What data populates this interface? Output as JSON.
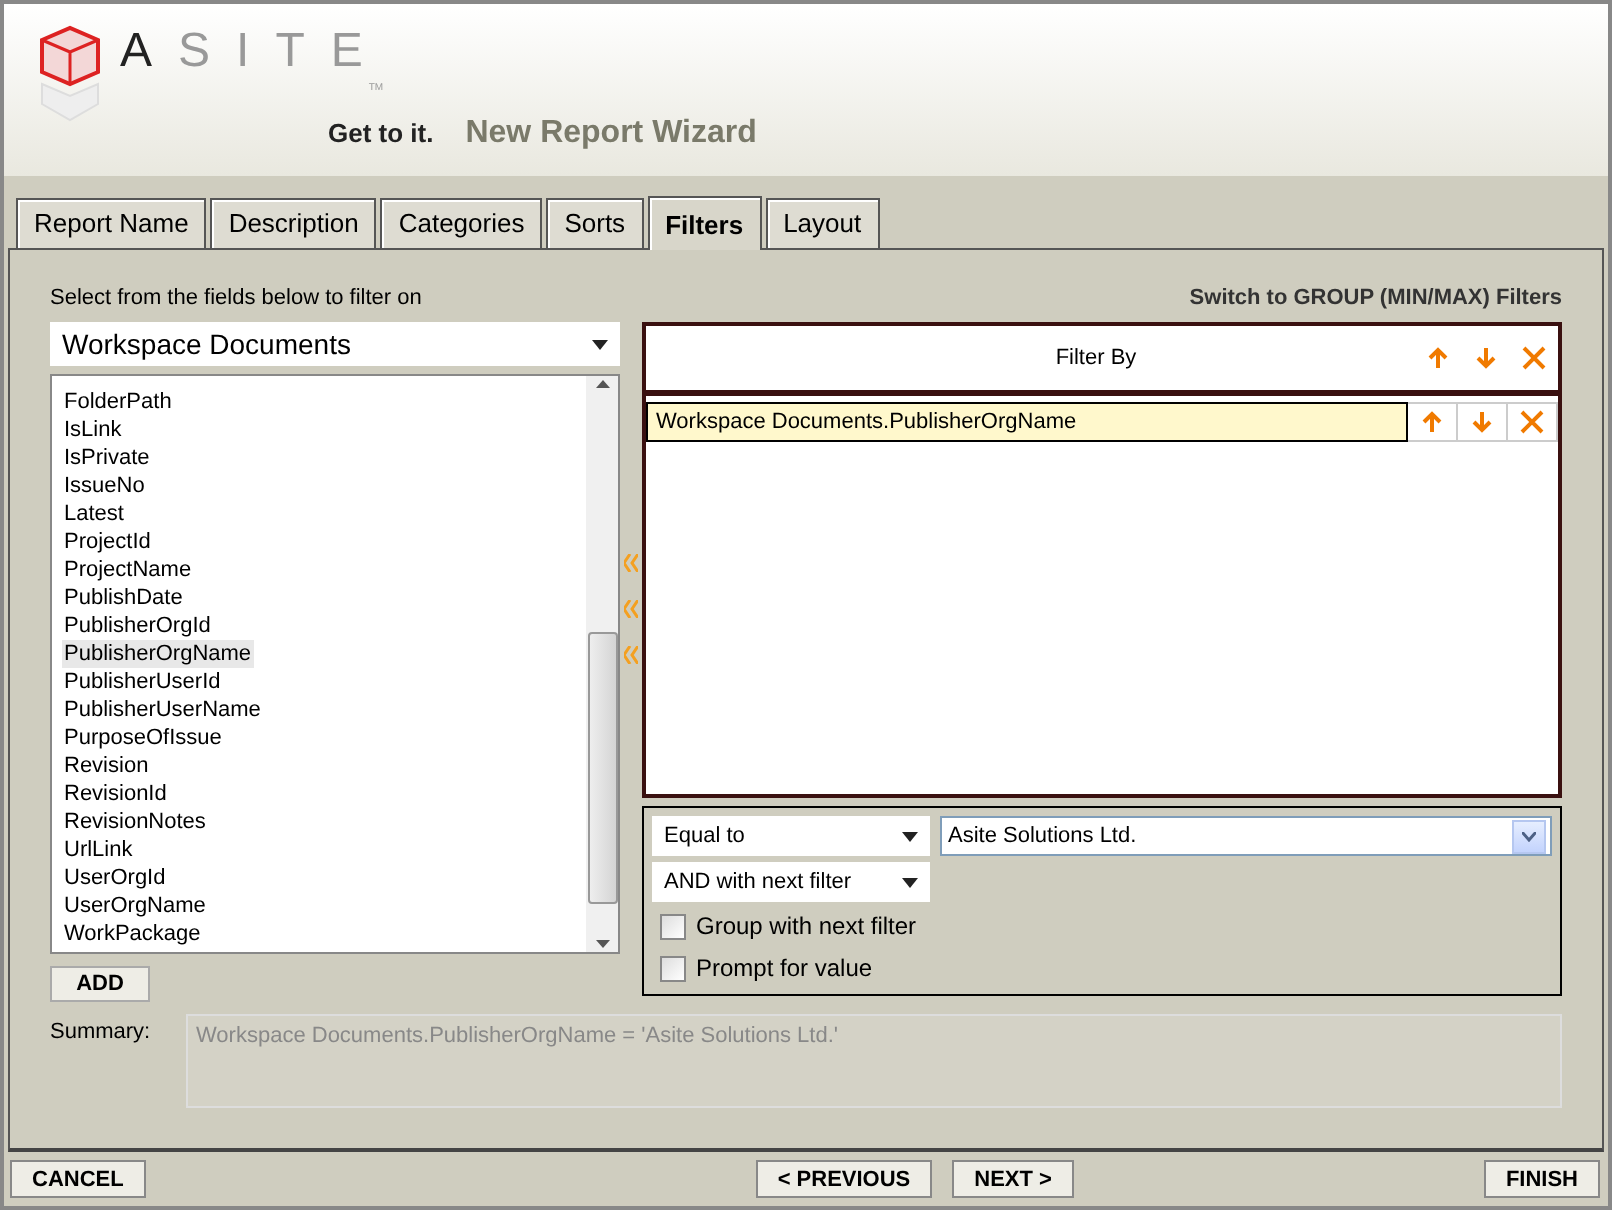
{
  "header": {
    "logo": {
      "first": "A",
      "rest": "SITE",
      "tm": "TM",
      "tagline": "Get to it."
    },
    "title": "New Report Wizard"
  },
  "tabs": [
    {
      "label": "Report Name",
      "selected": false
    },
    {
      "label": "Description",
      "selected": false
    },
    {
      "label": "Categories",
      "selected": false
    },
    {
      "label": "Sorts",
      "selected": false
    },
    {
      "label": "Filters",
      "selected": true
    },
    {
      "label": "Layout",
      "selected": false
    }
  ],
  "fields": {
    "instruction": "Select from the fields below to filter on",
    "source": "Workspace Documents",
    "items": [
      {
        "label": "FolderPath",
        "selected": false
      },
      {
        "label": "IsLink",
        "selected": false
      },
      {
        "label": "IsPrivate",
        "selected": false
      },
      {
        "label": "IssueNo",
        "selected": false
      },
      {
        "label": "Latest",
        "selected": false
      },
      {
        "label": "ProjectId",
        "selected": false
      },
      {
        "label": "ProjectName",
        "selected": false
      },
      {
        "label": "PublishDate",
        "selected": false
      },
      {
        "label": "PublisherOrgId",
        "selected": false
      },
      {
        "label": "PublisherOrgName",
        "selected": true
      },
      {
        "label": "PublisherUserId",
        "selected": false
      },
      {
        "label": "PublisherUserName",
        "selected": false
      },
      {
        "label": "PurposeOfIssue",
        "selected": false
      },
      {
        "label": "Revision",
        "selected": false
      },
      {
        "label": "RevisionId",
        "selected": false
      },
      {
        "label": "RevisionNotes",
        "selected": false
      },
      {
        "label": "UrlLink",
        "selected": false
      },
      {
        "label": "UserOrgId",
        "selected": false
      },
      {
        "label": "UserOrgName",
        "selected": false
      },
      {
        "label": "WorkPackage",
        "selected": false
      }
    ],
    "add_button": "ADD"
  },
  "switch_link": "Switch to GROUP (MIN/MAX) Filters",
  "filter_by": {
    "heading": "Filter By",
    "rows": [
      {
        "label": "Workspace Documents.PublisherOrgName",
        "selected": true
      }
    ]
  },
  "condition": {
    "operator": "Equal to",
    "value": "Asite Solutions Ltd.",
    "join": "AND with next filter",
    "options": [
      {
        "label": "Group with next filter",
        "checked": false
      },
      {
        "label": "Prompt for value",
        "checked": false
      }
    ]
  },
  "summary": {
    "label": "Summary:",
    "text": "Workspace Documents.PublisherOrgName = 'Asite Solutions Ltd.'"
  },
  "buttons": {
    "cancel": "CANCEL",
    "previous": "< PREVIOUS",
    "next": "NEXT >",
    "finish": "FINISH"
  }
}
